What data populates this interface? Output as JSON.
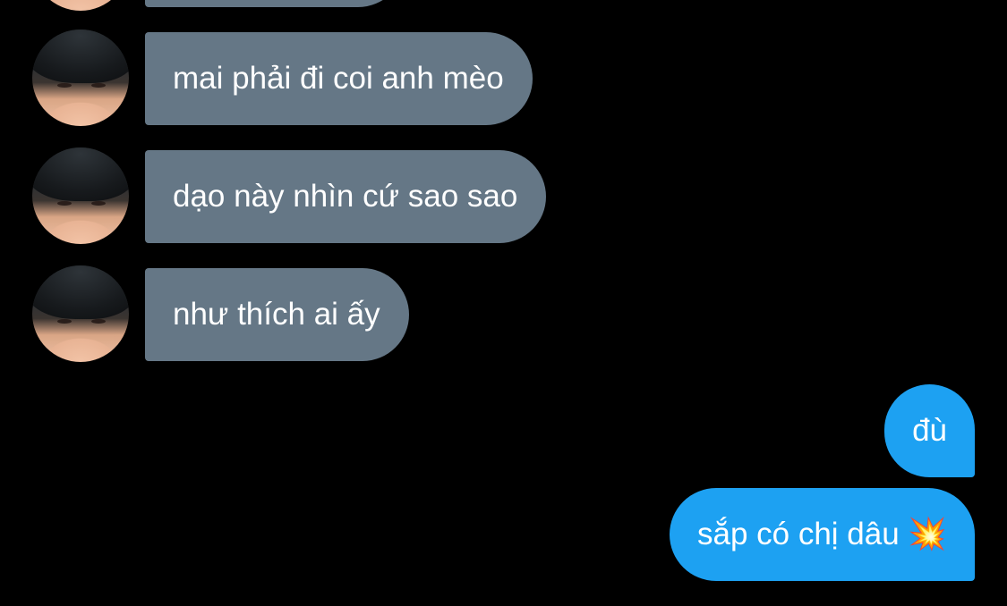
{
  "conversation": {
    "incoming": [
      {
        "text": ""
      },
      {
        "text": "mai phải đi coi anh mèo"
      },
      {
        "text": "dạo này nhìn cứ sao sao"
      },
      {
        "text": "như thích ai ấy"
      }
    ],
    "outgoing": [
      {
        "text": "đù"
      },
      {
        "text": "sắp có chị dâu 💥"
      }
    ]
  },
  "colors": {
    "background": "#000000",
    "incoming_bubble": "#657786",
    "outgoing_bubble": "#1da1f2",
    "text": "#ffffff"
  }
}
